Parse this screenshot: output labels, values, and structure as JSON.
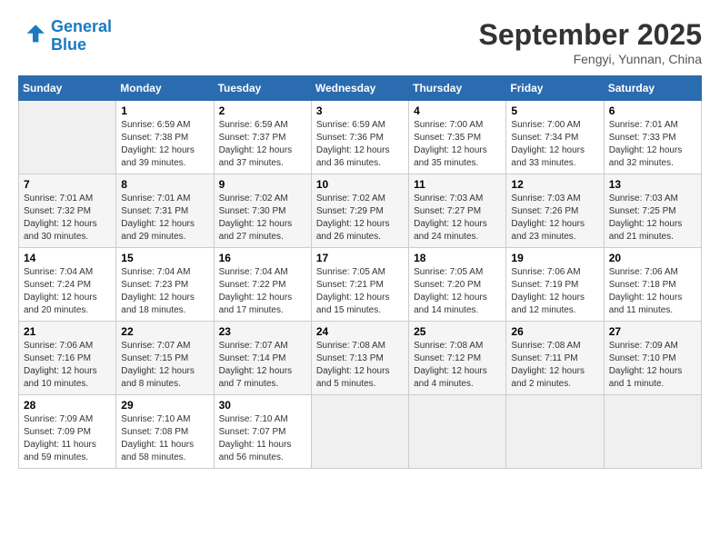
{
  "header": {
    "logo_line1": "General",
    "logo_line2": "Blue",
    "month_title": "September 2025",
    "location": "Fengyi, Yunnan, China"
  },
  "weekdays": [
    "Sunday",
    "Monday",
    "Tuesday",
    "Wednesday",
    "Thursday",
    "Friday",
    "Saturday"
  ],
  "weeks": [
    [
      null,
      {
        "day": "1",
        "sunrise": "6:59 AM",
        "sunset": "7:38 PM",
        "daylight": "12 hours and 39 minutes."
      },
      {
        "day": "2",
        "sunrise": "6:59 AM",
        "sunset": "7:37 PM",
        "daylight": "12 hours and 37 minutes."
      },
      {
        "day": "3",
        "sunrise": "6:59 AM",
        "sunset": "7:36 PM",
        "daylight": "12 hours and 36 minutes."
      },
      {
        "day": "4",
        "sunrise": "7:00 AM",
        "sunset": "7:35 PM",
        "daylight": "12 hours and 35 minutes."
      },
      {
        "day": "5",
        "sunrise": "7:00 AM",
        "sunset": "7:34 PM",
        "daylight": "12 hours and 33 minutes."
      },
      {
        "day": "6",
        "sunrise": "7:01 AM",
        "sunset": "7:33 PM",
        "daylight": "12 hours and 32 minutes."
      }
    ],
    [
      {
        "day": "7",
        "sunrise": "7:01 AM",
        "sunset": "7:32 PM",
        "daylight": "12 hours and 30 minutes."
      },
      {
        "day": "8",
        "sunrise": "7:01 AM",
        "sunset": "7:31 PM",
        "daylight": "12 hours and 29 minutes."
      },
      {
        "day": "9",
        "sunrise": "7:02 AM",
        "sunset": "7:30 PM",
        "daylight": "12 hours and 27 minutes."
      },
      {
        "day": "10",
        "sunrise": "7:02 AM",
        "sunset": "7:29 PM",
        "daylight": "12 hours and 26 minutes."
      },
      {
        "day": "11",
        "sunrise": "7:03 AM",
        "sunset": "7:27 PM",
        "daylight": "12 hours and 24 minutes."
      },
      {
        "day": "12",
        "sunrise": "7:03 AM",
        "sunset": "7:26 PM",
        "daylight": "12 hours and 23 minutes."
      },
      {
        "day": "13",
        "sunrise": "7:03 AM",
        "sunset": "7:25 PM",
        "daylight": "12 hours and 21 minutes."
      }
    ],
    [
      {
        "day": "14",
        "sunrise": "7:04 AM",
        "sunset": "7:24 PM",
        "daylight": "12 hours and 20 minutes."
      },
      {
        "day": "15",
        "sunrise": "7:04 AM",
        "sunset": "7:23 PM",
        "daylight": "12 hours and 18 minutes."
      },
      {
        "day": "16",
        "sunrise": "7:04 AM",
        "sunset": "7:22 PM",
        "daylight": "12 hours and 17 minutes."
      },
      {
        "day": "17",
        "sunrise": "7:05 AM",
        "sunset": "7:21 PM",
        "daylight": "12 hours and 15 minutes."
      },
      {
        "day": "18",
        "sunrise": "7:05 AM",
        "sunset": "7:20 PM",
        "daylight": "12 hours and 14 minutes."
      },
      {
        "day": "19",
        "sunrise": "7:06 AM",
        "sunset": "7:19 PM",
        "daylight": "12 hours and 12 minutes."
      },
      {
        "day": "20",
        "sunrise": "7:06 AM",
        "sunset": "7:18 PM",
        "daylight": "12 hours and 11 minutes."
      }
    ],
    [
      {
        "day": "21",
        "sunrise": "7:06 AM",
        "sunset": "7:16 PM",
        "daylight": "12 hours and 10 minutes."
      },
      {
        "day": "22",
        "sunrise": "7:07 AM",
        "sunset": "7:15 PM",
        "daylight": "12 hours and 8 minutes."
      },
      {
        "day": "23",
        "sunrise": "7:07 AM",
        "sunset": "7:14 PM",
        "daylight": "12 hours and 7 minutes."
      },
      {
        "day": "24",
        "sunrise": "7:08 AM",
        "sunset": "7:13 PM",
        "daylight": "12 hours and 5 minutes."
      },
      {
        "day": "25",
        "sunrise": "7:08 AM",
        "sunset": "7:12 PM",
        "daylight": "12 hours and 4 minutes."
      },
      {
        "day": "26",
        "sunrise": "7:08 AM",
        "sunset": "7:11 PM",
        "daylight": "12 hours and 2 minutes."
      },
      {
        "day": "27",
        "sunrise": "7:09 AM",
        "sunset": "7:10 PM",
        "daylight": "12 hours and 1 minute."
      }
    ],
    [
      {
        "day": "28",
        "sunrise": "7:09 AM",
        "sunset": "7:09 PM",
        "daylight": "11 hours and 59 minutes."
      },
      {
        "day": "29",
        "sunrise": "7:10 AM",
        "sunset": "7:08 PM",
        "daylight": "11 hours and 58 minutes."
      },
      {
        "day": "30",
        "sunrise": "7:10 AM",
        "sunset": "7:07 PM",
        "daylight": "11 hours and 56 minutes."
      },
      null,
      null,
      null,
      null
    ]
  ],
  "labels": {
    "sunrise_prefix": "Sunrise: ",
    "sunset_prefix": "Sunset: ",
    "daylight_prefix": "Daylight: "
  }
}
